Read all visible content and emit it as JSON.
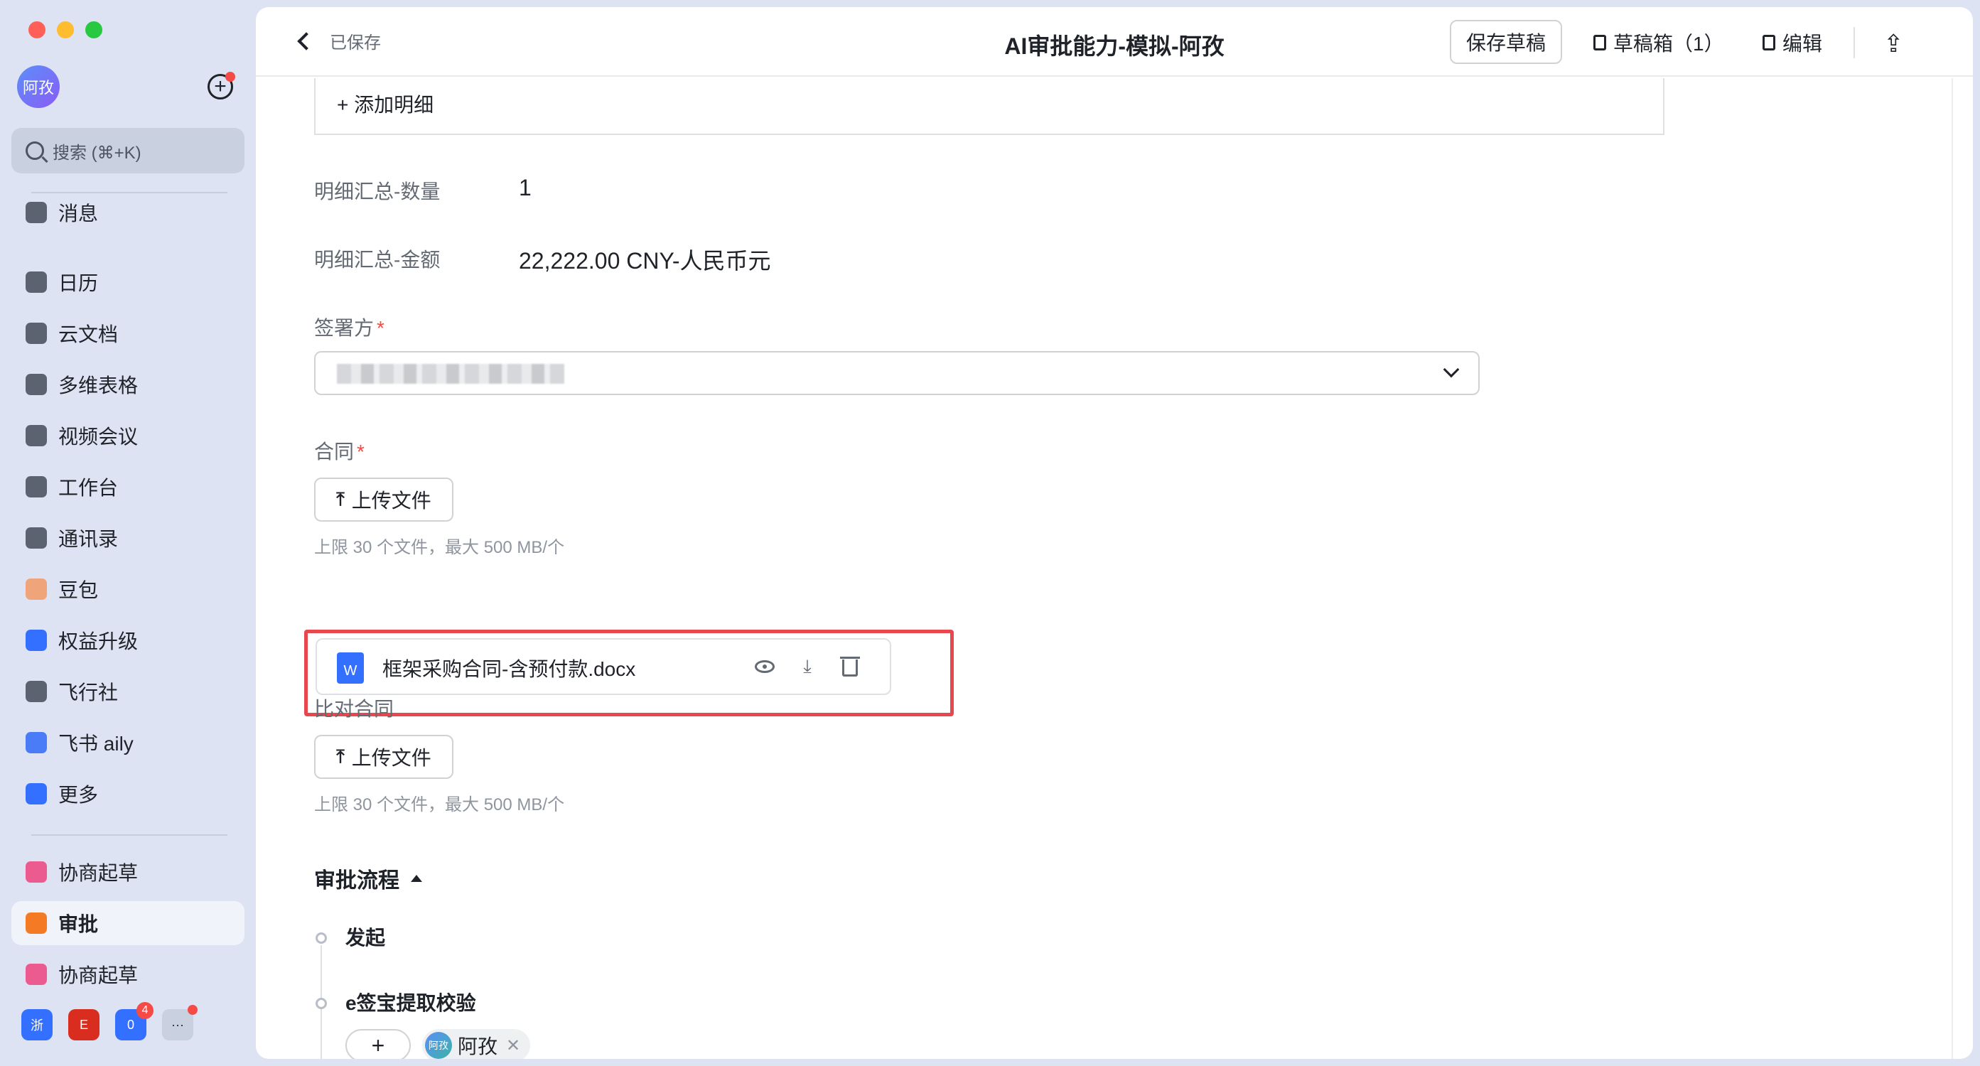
{
  "sidebar": {
    "avatar_text": "阿孜",
    "search": {
      "label": "搜索 (⌘+K)"
    },
    "items": [
      {
        "label": "消息",
        "icon": "message-icon",
        "color": "#5b6270"
      },
      {
        "label": "日历",
        "icon": "calendar-icon",
        "color": "#5b6270"
      },
      {
        "label": "云文档",
        "icon": "cloud-doc-icon",
        "color": "#5b6270"
      },
      {
        "label": "多维表格",
        "icon": "base-table-icon",
        "color": "#5b6270"
      },
      {
        "label": "视频会议",
        "icon": "video-icon",
        "color": "#5b6270"
      },
      {
        "label": "工作台",
        "icon": "workplace-icon",
        "color": "#5b6270"
      },
      {
        "label": "通讯录",
        "icon": "contacts-icon",
        "color": "#5b6270"
      },
      {
        "label": "豆包",
        "icon": "doubao-icon",
        "color": "#f0a47a"
      },
      {
        "label": "权益升级",
        "icon": "diamond-icon",
        "color": "#3370ff"
      },
      {
        "label": "飞行社",
        "icon": "flight-club-icon",
        "color": "#5b6270"
      },
      {
        "label": "飞书 aily",
        "icon": "aily-icon",
        "color": "#4a7cf7"
      },
      {
        "label": "更多",
        "icon": "more-apps-icon",
        "color": "#3370ff"
      },
      {
        "label": "协商起草",
        "icon": "draft-app-icon",
        "color": "#ec5b8f"
      },
      {
        "label": "审批",
        "icon": "approval-app-icon",
        "color": "#f57a25"
      },
      {
        "label": "协商起草",
        "icon": "draft-app-icon",
        "color": "#ec5b8f"
      }
    ],
    "dock": [
      {
        "text": "浙",
        "color": "#3370ff",
        "icon": "zhe-app-icon"
      },
      {
        "text": "E",
        "color": "#d92d20",
        "icon": "e-app-icon"
      },
      {
        "text": "0",
        "color": "#3370ff",
        "icon": "zero-app-icon",
        "badge": "4"
      },
      {
        "text": "···",
        "color": "#c9d0df",
        "icon": "more-icon"
      }
    ]
  },
  "header": {
    "back_label": "已保存",
    "title": "AI审批能力-模拟-阿孜",
    "save_draft": "保存草稿",
    "drafts": "草稿箱（1）",
    "edit": "编辑"
  },
  "form": {
    "add_detail": "+ 添加明细",
    "qty_label": "明细汇总-数量",
    "qty_value": "1",
    "amount_label": "明细汇总-金额",
    "amount_value": "22,222.00 CNY-人民币元",
    "signer_label": "签署方",
    "required_mark": "*",
    "contract_label": "合同",
    "upload_label": "上传文件",
    "upload_hint": "上限 30 个文件，最大 500 MB/个",
    "file": {
      "name": "框架采购合同-含预付款.docx",
      "type_letter": "W"
    },
    "compare_label": "比对合同"
  },
  "flow": {
    "title": "审批流程",
    "steps": [
      "发起",
      "e签宝提取校验"
    ],
    "add": "+",
    "approver": {
      "avatar": "阿孜",
      "name": "阿孜",
      "remove": "✕"
    }
  },
  "colors": {
    "accent": "#3370ff",
    "highlight": "#e8474d",
    "danger": "#f54a45"
  }
}
